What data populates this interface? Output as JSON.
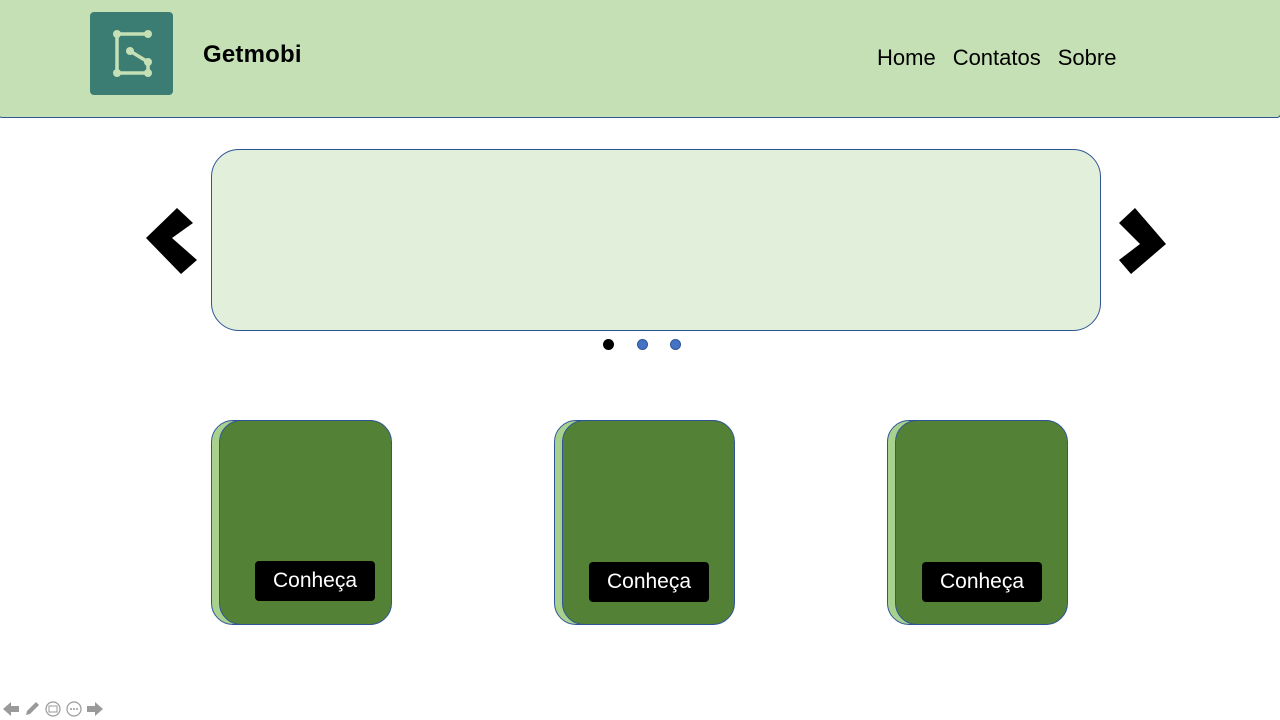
{
  "header": {
    "brand": "Getmobi",
    "nav": [
      "Home",
      "Contatos",
      "Sobre"
    ]
  },
  "carousel": {
    "prev_icon": "chevron-left-icon",
    "next_icon": "chevron-right-icon",
    "active_index": 0,
    "slide_count": 3
  },
  "cards": [
    {
      "button": "Conheça"
    },
    {
      "button": "Conheça"
    },
    {
      "button": "Conheça"
    }
  ],
  "toolbar": {
    "icons": [
      "previous-icon",
      "pen-icon",
      "slides-icon",
      "more-icon",
      "next-icon"
    ]
  },
  "colors": {
    "header_bg": "#c5e0b4",
    "logo_bg": "#3b7d72",
    "carousel_bg": "#e2efda",
    "card_front": "#538135",
    "card_back": "#a9d18e",
    "outline": "#2f5597",
    "dot_inactive": "#4472c4"
  }
}
